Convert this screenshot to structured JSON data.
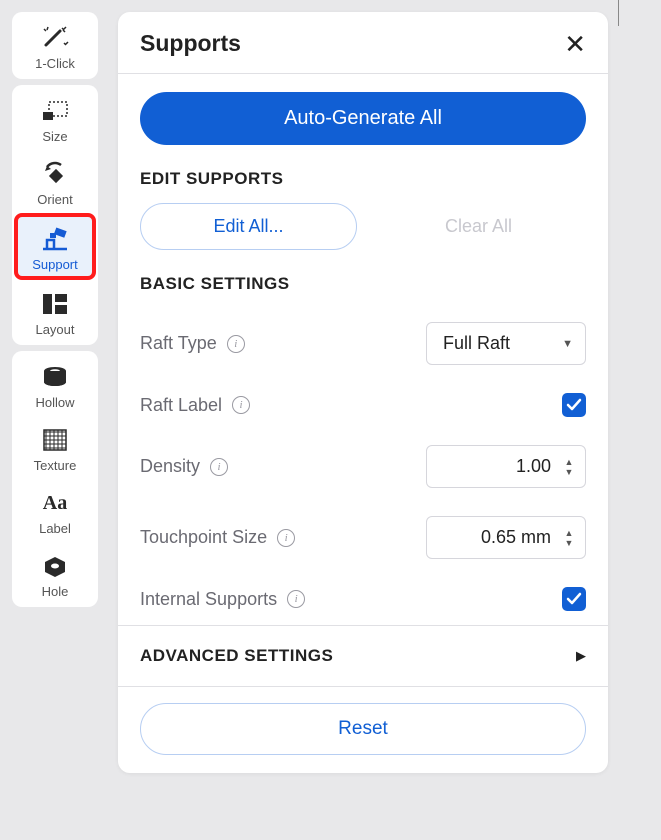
{
  "sidebar": {
    "items": [
      {
        "label": "1-Click",
        "icon": "wand-icon"
      },
      {
        "label": "Size",
        "icon": "size-icon"
      },
      {
        "label": "Orient",
        "icon": "orient-icon"
      },
      {
        "label": "Support",
        "icon": "support-icon",
        "active": true
      },
      {
        "label": "Layout",
        "icon": "layout-icon"
      },
      {
        "label": "Hollow",
        "icon": "hollow-icon"
      },
      {
        "label": "Texture",
        "icon": "texture-icon"
      },
      {
        "label": "Label",
        "icon": "label-icon"
      },
      {
        "label": "Hole",
        "icon": "hole-icon"
      }
    ]
  },
  "panel": {
    "title": "Supports",
    "auto_generate_label": "Auto-Generate All",
    "edit_supports_heading": "EDIT SUPPORTS",
    "edit_all_label": "Edit All...",
    "clear_all_label": "Clear All",
    "basic_settings_heading": "BASIC SETTINGS",
    "raft_type_label": "Raft Type",
    "raft_type_value": "Full Raft",
    "raft_label_label": "Raft Label",
    "raft_label_checked": true,
    "density_label": "Density",
    "density_value": "1.00",
    "touchpoint_label": "Touchpoint Size",
    "touchpoint_value": "0.65 mm",
    "internal_supports_label": "Internal Supports",
    "internal_supports_checked": true,
    "advanced_heading": "ADVANCED SETTINGS",
    "reset_label": "Reset"
  }
}
